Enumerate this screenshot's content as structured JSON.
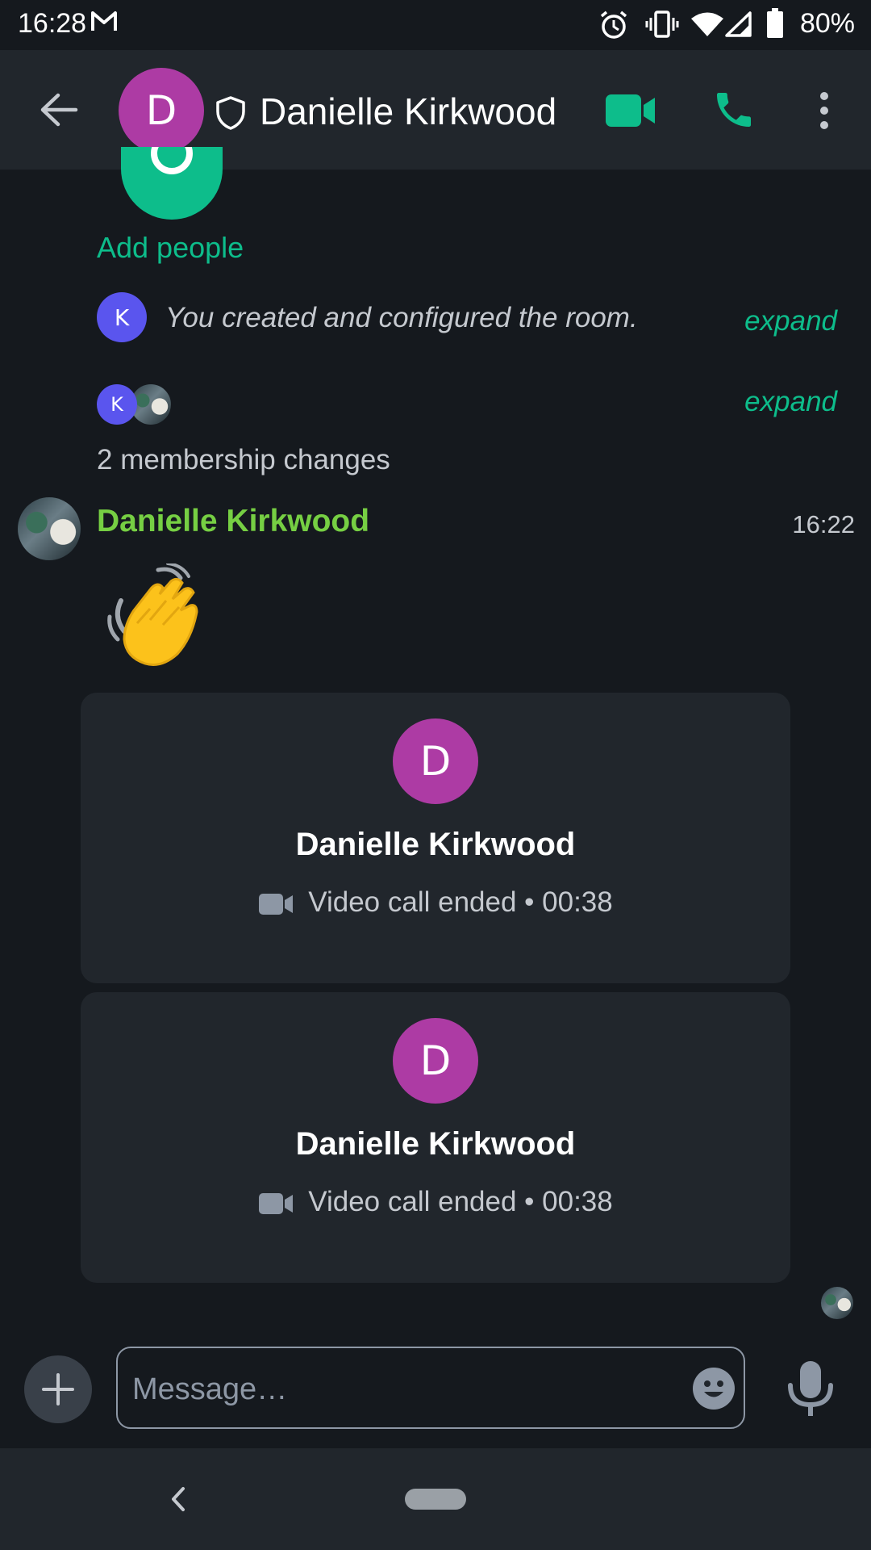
{
  "status_bar": {
    "time": "16:28",
    "battery": "80%",
    "icons": [
      "gmail-icon",
      "alarm-icon",
      "vibrate-icon",
      "wifi-icon",
      "signal-icon",
      "battery-icon"
    ]
  },
  "header": {
    "back_icon": "arrow-left-icon",
    "avatar_letter": "D",
    "shield_icon": "shield-icon",
    "title": "Danielle Kirkwood",
    "video_call_icon": "video-camera-icon",
    "voice_call_icon": "phone-icon",
    "menu_icon": "more-vertical-icon"
  },
  "timeline": {
    "add_people_label": "Add people",
    "created_event": {
      "avatar_letter": "K",
      "text": "You created and configured the room.",
      "expand_label": "expand"
    },
    "membership_event": {
      "avatar_letter": "K",
      "text": "2 membership changes",
      "expand_label": "expand"
    },
    "message": {
      "sender": "Danielle Kirkwood",
      "time": "16:22",
      "emoji": "waving-hand"
    },
    "calls": [
      {
        "avatar_letter": "D",
        "name": "Danielle Kirkwood",
        "status": "Video call ended • 00:38"
      },
      {
        "avatar_letter": "D",
        "name": "Danielle Kirkwood",
        "status": "Video call ended • 00:38"
      }
    ]
  },
  "composer": {
    "placeholder": "Message…",
    "add_icon": "plus-icon",
    "emoji_icon": "smiley-icon",
    "mic_icon": "microphone-icon"
  },
  "colors": {
    "background": "#15191e",
    "bar": "#21262c",
    "accent": "#0dbd8b",
    "avatar_d": "#ad3ba4",
    "avatar_k": "#5a55ee",
    "sender_name": "#76cf43"
  }
}
